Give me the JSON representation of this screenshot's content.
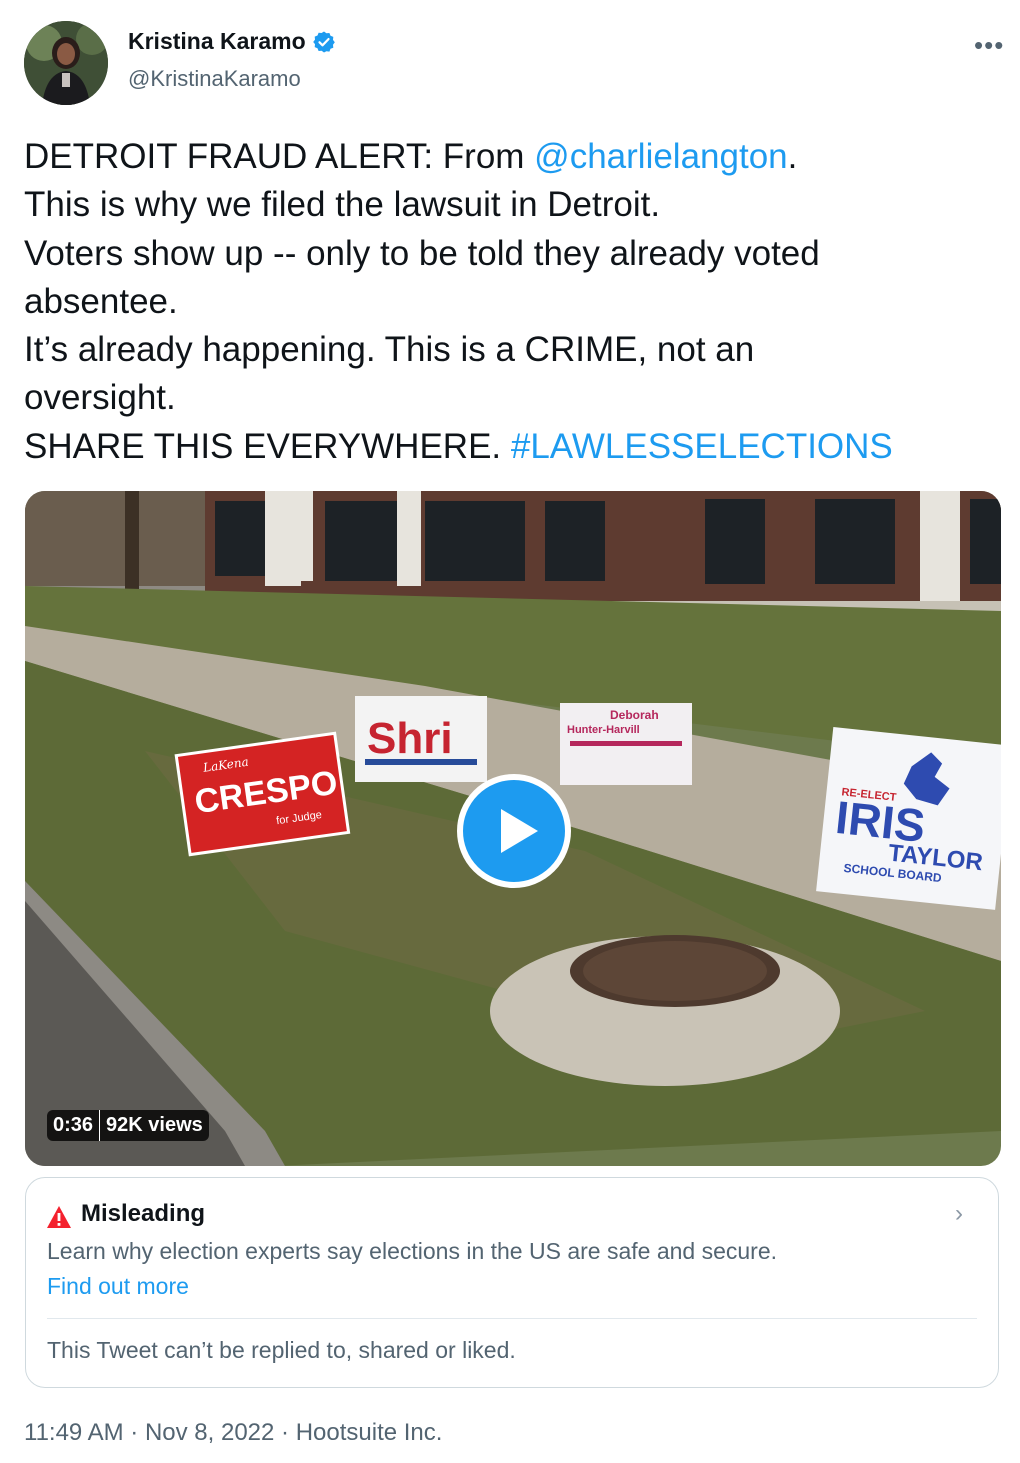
{
  "author": {
    "name": "Kristina Karamo",
    "handle": "@KristinaKaramo",
    "verified": true,
    "avatar": "profile-photo"
  },
  "menu_icon": "more-horizontal-icon",
  "tweet": {
    "line1_prefix": "DETROIT FRAUD ALERT: From ",
    "mention": "@charlielangton",
    "line1_suffix": ".",
    "line2": "This is why we filed the lawsuit in Detroit.",
    "line3": "Voters show up -- only to be told they already voted",
    "line4": "absentee.",
    "line5": "It’s already happening. This is a CRIME, not an",
    "line6": "oversight.",
    "line7_prefix": "SHARE THIS EVERYWHERE. ",
    "hashtag": "#LAWLESSELECTIONS"
  },
  "video": {
    "duration": "0:36",
    "views": "92K views",
    "play_icon": "play-icon",
    "signs": {
      "crespo_top": "LaKena",
      "crespo_main": "CRESPO",
      "crespo_bottom": "for Judge",
      "shri": "Shri",
      "deborah_line1": "Deborah",
      "deborah_line2": "Hunter-Harvill",
      "iris_top": "RE-ELECT",
      "iris_main": "IRIS",
      "iris_sub": "TAYLOR",
      "iris_small": "SCHOOL BOARD"
    }
  },
  "notice": {
    "icon": "warning-icon",
    "title": "Misleading",
    "description": "Learn why election experts say elections in the US are safe and secure.",
    "link": "Find out more",
    "restriction": "This Tweet can’t be replied to, shared or liked.",
    "chevron_icon": "chevron-right-icon"
  },
  "timestamp": "11:49 AM · Nov 8, 2022 · Hootsuite Inc.",
  "colors": {
    "link": "#1d9bf0",
    "secondary_text": "#536471",
    "warning": "#f4212e",
    "play": "#1d9bf0"
  }
}
